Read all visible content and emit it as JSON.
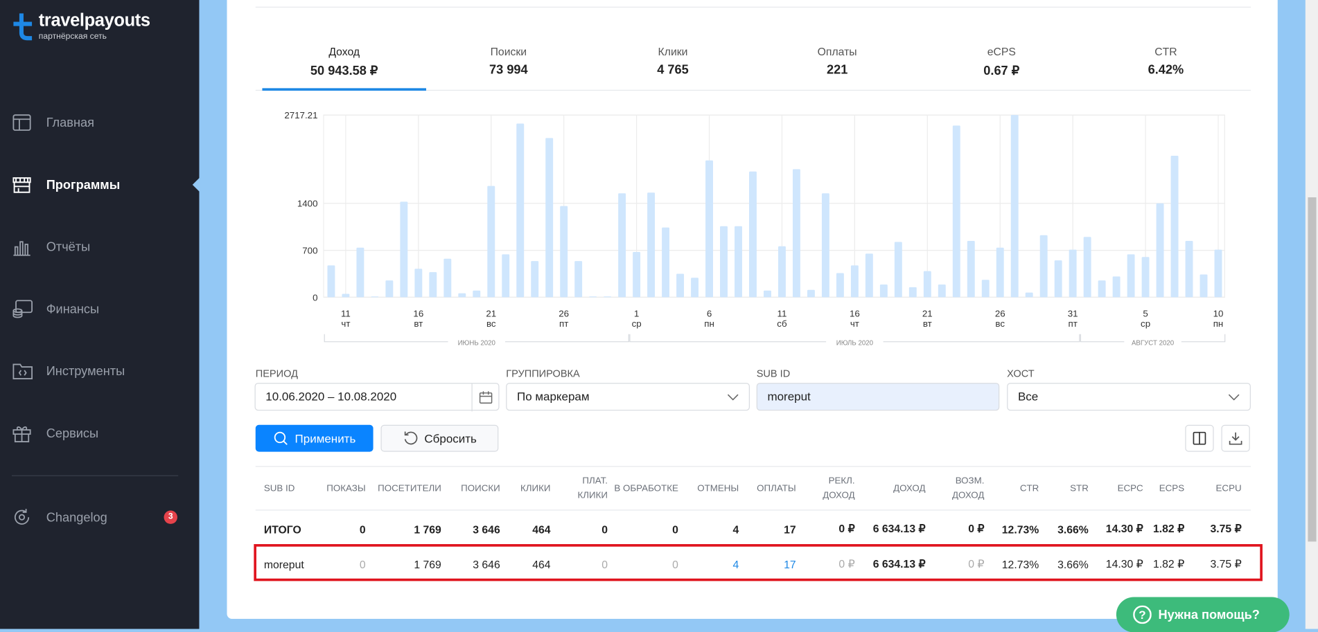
{
  "brand": {
    "name": "travelpayouts",
    "subtitle": "партнёрская сеть",
    "color": "#1e88e5"
  },
  "sidebar": {
    "items": [
      {
        "label": "Главная",
        "icon": "layout-icon"
      },
      {
        "label": "Программы",
        "icon": "store-icon",
        "active": true
      },
      {
        "label": "Отчёты",
        "icon": "bar-chart-icon"
      },
      {
        "label": "Финансы",
        "icon": "coins-icon"
      },
      {
        "label": "Инструменты",
        "icon": "folder-code-icon"
      },
      {
        "label": "Сервисы",
        "icon": "gift-icon"
      }
    ],
    "changelog": {
      "label": "Changelog",
      "badge": "3"
    }
  },
  "metrics": [
    {
      "title": "Доход",
      "value": "50 943.58 ₽",
      "active": true
    },
    {
      "title": "Поиски",
      "value": "73 994"
    },
    {
      "title": "Клики",
      "value": "4 765"
    },
    {
      "title": "Оплаты",
      "value": "221"
    },
    {
      "title": "eCPS",
      "value": "0.67 ₽"
    },
    {
      "title": "CTR",
      "value": "6.42%"
    }
  ],
  "chart_data": {
    "type": "bar",
    "title": "Доход",
    "ylim": [
      0,
      2717.21
    ],
    "yticks": [
      "0",
      "700",
      "1400",
      "2717.21"
    ],
    "x_start": "2020-06-10",
    "x_end": "2020-08-10",
    "values": [
      475,
      50,
      740,
      10,
      250,
      1425,
      425,
      375,
      575,
      60,
      100,
      1660,
      640,
      2590,
      540,
      2375,
      1360,
      540,
      10,
      10,
      1550,
      675,
      1560,
      1040,
      350,
      290,
      2040,
      1060,
      1060,
      1875,
      100,
      760,
      1910,
      110,
      1550,
      360,
      475,
      650,
      190,
      825,
      150,
      390,
      190,
      2560,
      840,
      260,
      740,
      2717.21,
      70,
      925,
      550,
      710,
      900,
      250,
      310,
      640,
      600,
      1400,
      2110,
      840,
      340,
      710
    ],
    "xticks": [
      {
        "day": "11",
        "wd": "чт",
        "i": 1
      },
      {
        "day": "16",
        "wd": "вт",
        "i": 6
      },
      {
        "day": "21",
        "wd": "вс",
        "i": 11
      },
      {
        "day": "26",
        "wd": "пт",
        "i": 16
      },
      {
        "day": "1",
        "wd": "ср",
        "i": 21
      },
      {
        "day": "6",
        "wd": "пн",
        "i": 26
      },
      {
        "day": "11",
        "wd": "сб",
        "i": 31
      },
      {
        "day": "16",
        "wd": "чт",
        "i": 36
      },
      {
        "day": "21",
        "wd": "вт",
        "i": 41
      },
      {
        "day": "26",
        "wd": "вс",
        "i": 46
      },
      {
        "day": "31",
        "wd": "пт",
        "i": 51
      },
      {
        "day": "5",
        "wd": "ср",
        "i": 56
      },
      {
        "day": "10",
        "wd": "пн",
        "i": 61
      }
    ],
    "months": [
      {
        "label": "ИЮНЬ 2020",
        "from": 0,
        "to": 20
      },
      {
        "label": "ИЮЛЬ 2020",
        "from": 21,
        "to": 51
      },
      {
        "label": "АВГУСТ 2020",
        "from": 52,
        "to": 61
      }
    ]
  },
  "filters": {
    "period": {
      "label": "ПЕРИОД",
      "value": "10.06.2020 – 10.08.2020"
    },
    "grouping": {
      "label": "ГРУППИРОВКА",
      "value": "По маркерам"
    },
    "subid": {
      "label": "SUB ID",
      "value": "moreput"
    },
    "host": {
      "label": "ХОСТ",
      "value": "Все"
    }
  },
  "buttons": {
    "apply": "Применить",
    "reset": "Сбросить"
  },
  "table": {
    "headers": [
      "SUB ID",
      "ПОКАЗЫ",
      "ПОСЕТИТЕЛИ",
      "ПОИСКИ",
      "КЛИКИ",
      "ПЛАТ. КЛИКИ",
      "В ОБРАБОТКЕ",
      "ОТМЕНЫ",
      "ОПЛАТЫ",
      "РЕКЛ. ДОХОД",
      "ДОХОД",
      "ВОЗМ. ДОХОД",
      "CTR",
      "STR",
      "ECPC",
      "ECPS",
      "ECPU"
    ],
    "total": [
      "ИТОГО",
      "0",
      "1 769",
      "3 646",
      "464",
      "0",
      "0",
      "4",
      "17",
      "0 ₽",
      "6 634.13 ₽",
      "0 ₽",
      "12.73%",
      "3.66%",
      "14.30 ₽",
      "1.82 ₽",
      "3.75 ₽"
    ],
    "rows": [
      [
        "moreput",
        "0",
        "1 769",
        "3 646",
        "464",
        "0",
        "0",
        "4",
        "17",
        "0 ₽",
        "6 634.13 ₽",
        "0 ₽",
        "12.73%",
        "3.66%",
        "14.30 ₽",
        "1.82 ₽",
        "3.75 ₽"
      ]
    ]
  },
  "help": {
    "label": "Нужна помощь?"
  }
}
